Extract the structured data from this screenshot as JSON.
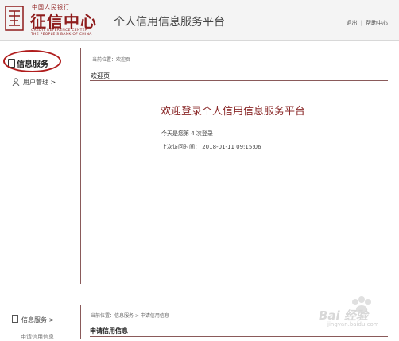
{
  "header": {
    "logo_top": "中国人民银行",
    "logo_name": "征信中心",
    "logo_en_line1": "CREDIT REFERENCE CENTER",
    "logo_en_line2": "THE PEOPLE'S BANK OF CHINA",
    "platform_title": "个人信用信息服务平台",
    "links": [
      "退出",
      "帮助中心"
    ]
  },
  "sidebar": {
    "items": [
      {
        "label": "信息服务",
        "icon": "document-icon"
      },
      {
        "label": "用户管理 >",
        "icon": "user-icon"
      }
    ]
  },
  "main": {
    "breadcrumb": "当前位置：欢迎页",
    "section_title": "欢迎页",
    "welcome": "欢迎登录个人信用信息服务平台",
    "login_count": "今天是您第 4 次登录",
    "last_visit": "上次访问时间： 2018-01-11 09:15:06"
  },
  "bottom": {
    "nav_label": "信息服务 >",
    "nav_sub": "申请信用信息",
    "breadcrumb": "当前位置：信息服务 > 申请信用信息",
    "title": "申请信用信息"
  },
  "watermark": {
    "text": "Bai 经验",
    "url": "jingyan.baidu.com"
  },
  "colors": {
    "brand": "#8e1b1b",
    "highlight": "#b01c1c",
    "divider": "#8a5a5a"
  }
}
